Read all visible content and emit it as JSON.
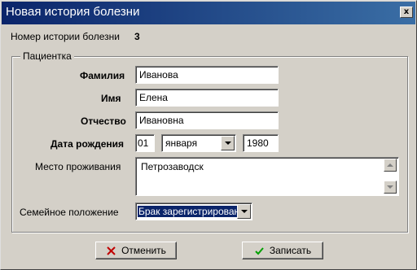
{
  "window": {
    "title": "Новая история болезни",
    "close_symbol": "x"
  },
  "record": {
    "number_label": "Номер истории болезни",
    "number_value": "3"
  },
  "patient": {
    "group_label": "Пациентка",
    "surname_label": "Фамилия",
    "surname_value": "Иванова",
    "name_label": "Имя",
    "name_value": "Елена",
    "patronymic_label": "Отчество",
    "patronymic_value": "Ивановна",
    "birthdate_label": "Дата рождения",
    "birth_day": "01",
    "birth_month": "января",
    "birth_year": "1980",
    "residence_label": "Место проживания",
    "residence_value": "Петрозаводск",
    "marital_label": "Семейное положение",
    "marital_value": "Брак зарегистрирован"
  },
  "buttons": {
    "cancel_label": "Отменить",
    "save_label": "Записать"
  },
  "colors": {
    "cancel_icon": "#c00000",
    "save_icon": "#00a000",
    "title_bar": "#0a246a"
  },
  "icons": {
    "cancel": "cross-icon",
    "save": "checkmark-icon"
  }
}
